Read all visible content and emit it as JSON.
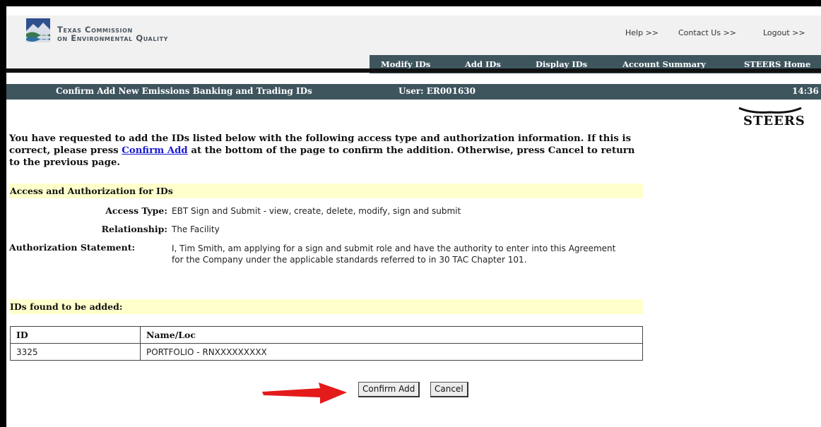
{
  "header": {
    "org_line1": "Texas Commission",
    "org_line2": "on Environmental Quality",
    "links": {
      "help": "Help >>",
      "contact": "Contact Us >>",
      "logout": "Logout >>"
    },
    "nav": [
      "Modify IDs",
      "Add IDs",
      "Display IDs",
      "Account Summary",
      "STEERS Home"
    ]
  },
  "titlebar": {
    "title": "Confirm Add New Emissions Banking and Trading IDs",
    "user": "User: ER001630",
    "time": "14:36"
  },
  "brand": "STEERS",
  "intro": {
    "before_link": "You have requested to add the IDs listed below with the following access type and authorization information. If this is correct, please press ",
    "link": "Confirm Add",
    "after_link": " at the bottom of the page to confirm the addition. Otherwise, press Cancel to return to the previous page."
  },
  "access": {
    "section_title": "Access and Authorization for IDs",
    "access_type_label": "Access Type:",
    "access_type": "EBT Sign and Submit - view, create, delete, modify, sign and submit",
    "relationship_label": "Relationship:",
    "relationship": "The Facility",
    "auth_label": "Authorization Statement:",
    "auth_statement": "I, Tim Smith, am applying for a sign and submit role and have the authority to enter into this Agreement for the Company under the applicable standards referred to in 30 TAC Chapter 101."
  },
  "ids": {
    "section_title": "IDs found to be added:",
    "columns": [
      "ID",
      "Name/Loc"
    ],
    "rows": [
      {
        "id": "3325",
        "name": "PORTFOLIO - RNXXXXXXXXX"
      }
    ]
  },
  "buttons": {
    "confirm": "Confirm Add",
    "cancel": "Cancel"
  },
  "colors": {
    "nav_bg": "#3e555e",
    "band_bg": "#ffffcc",
    "annotation_arrow": "#e41b1b",
    "link": "#1a1ad0"
  }
}
